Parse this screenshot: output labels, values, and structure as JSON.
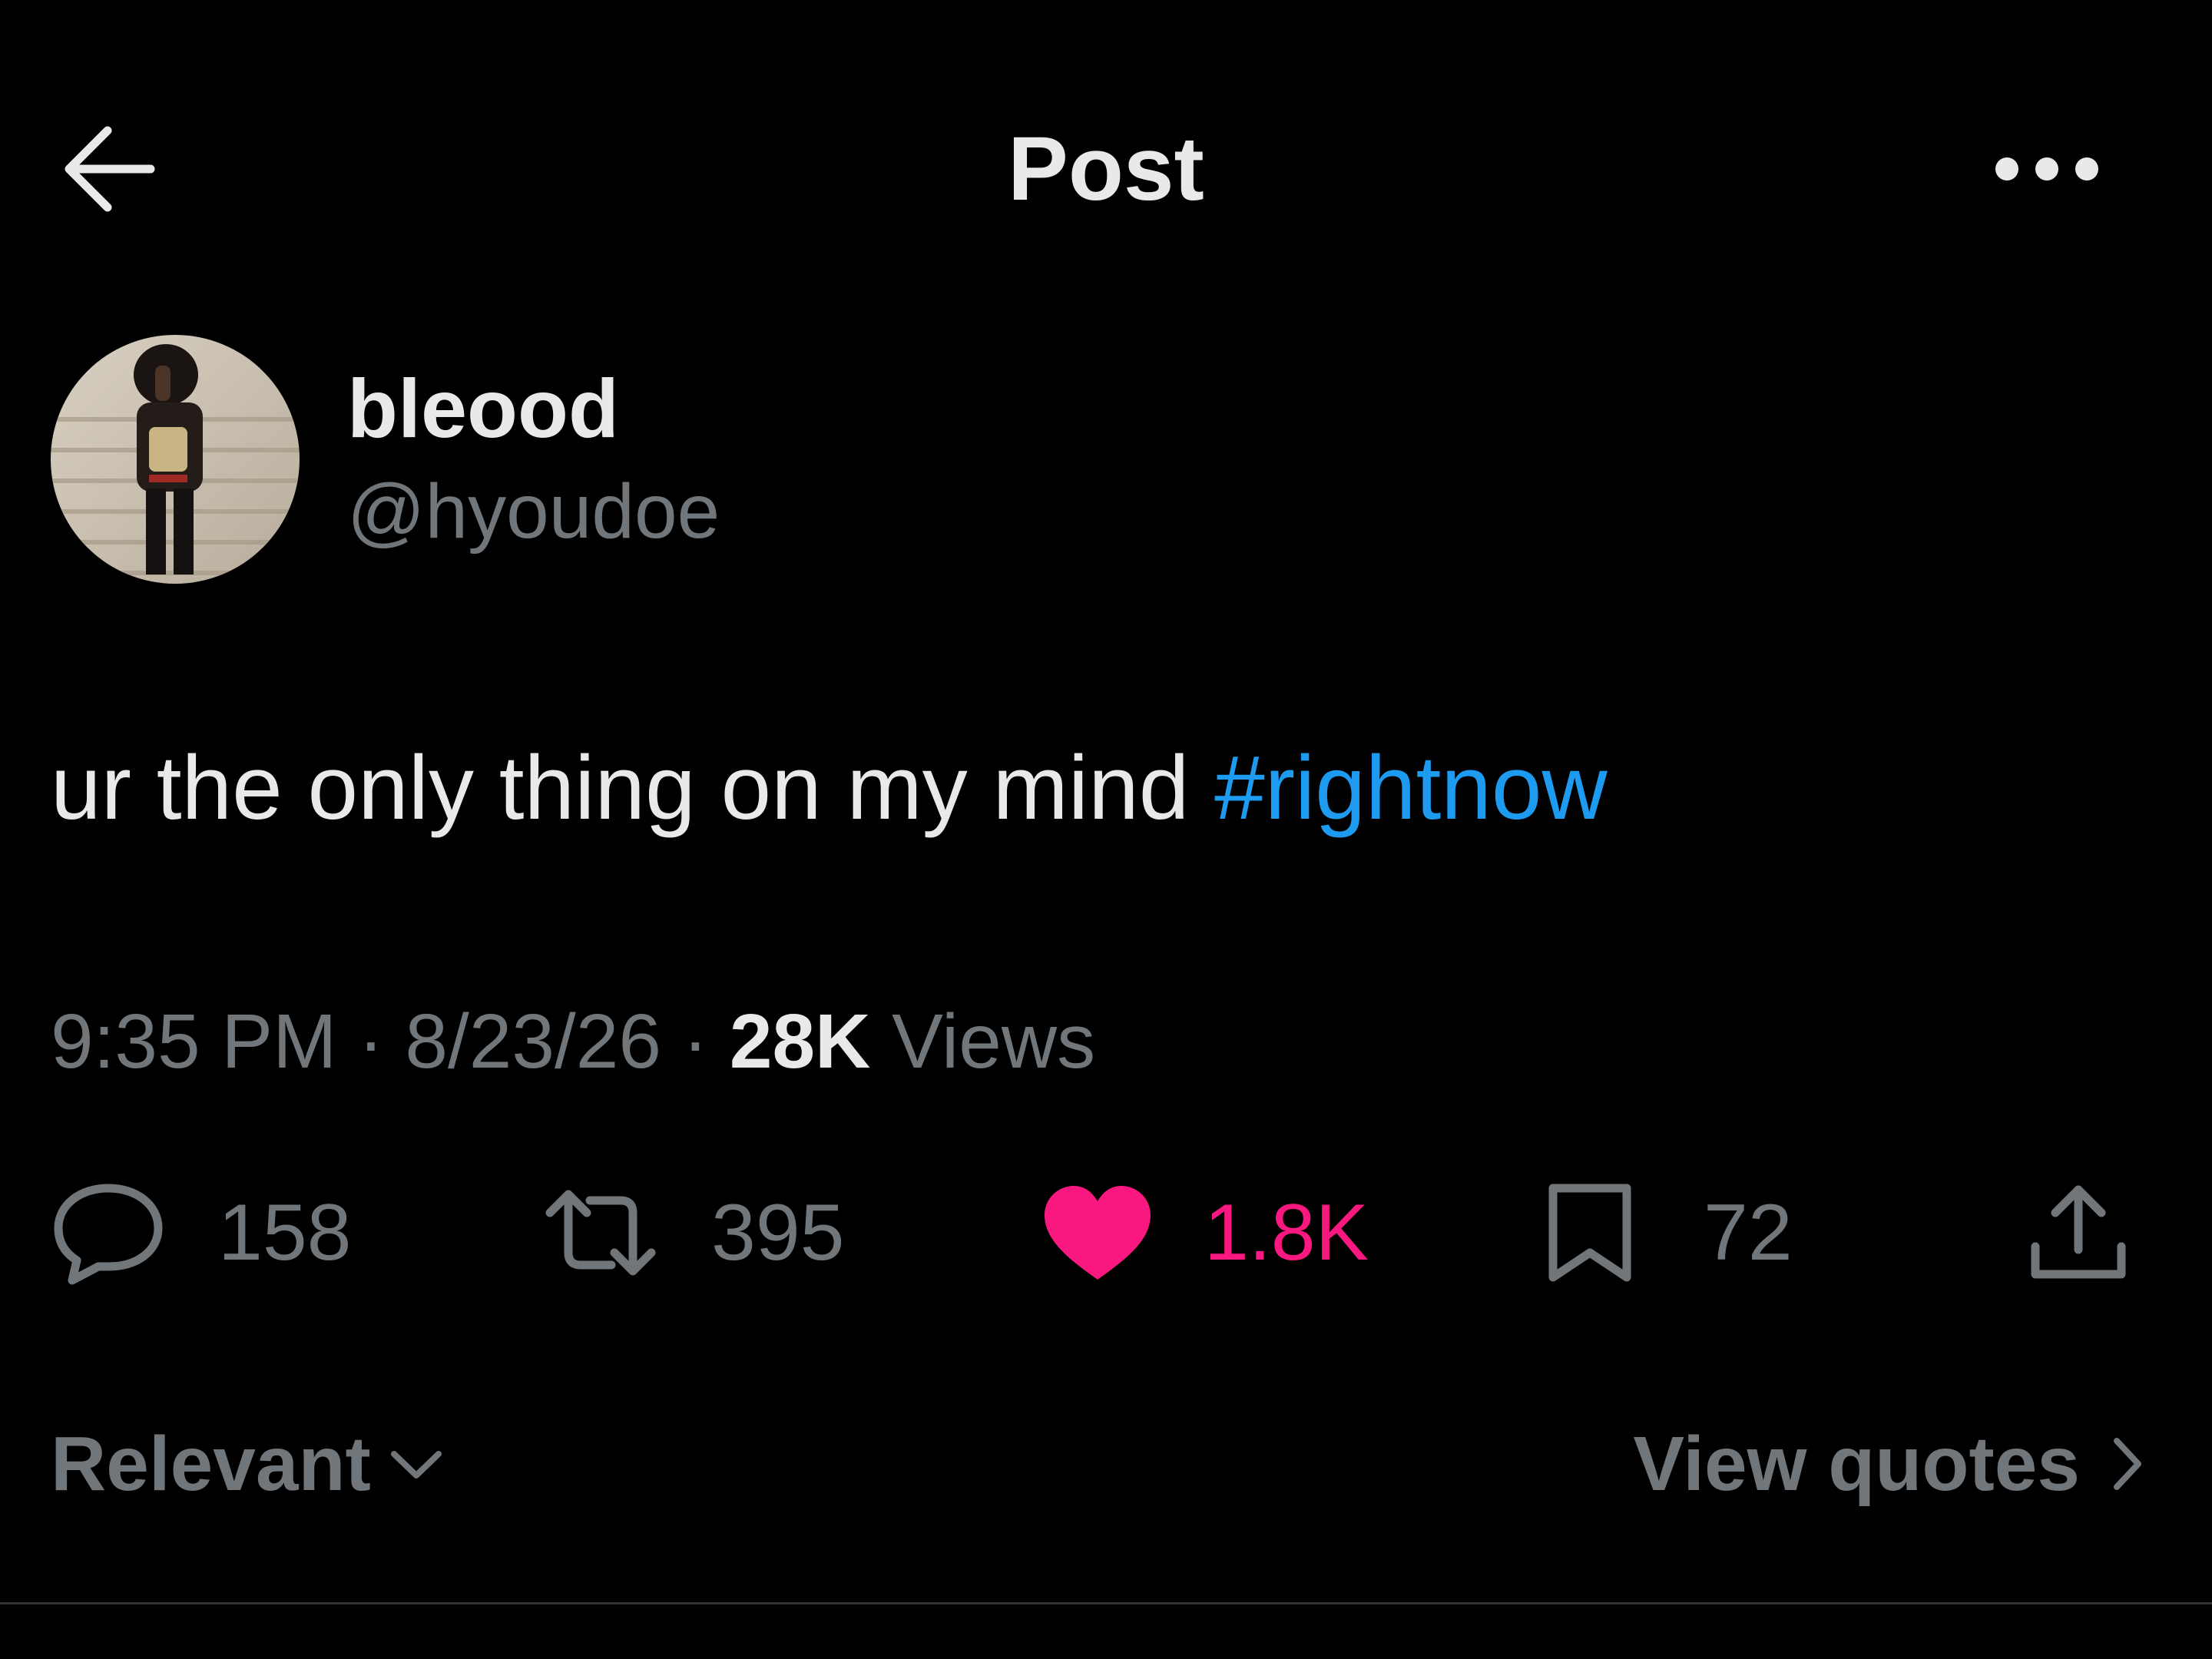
{
  "header": {
    "title": "Post",
    "back_icon": "arrow-left-icon",
    "more_icon": "ellipsis-icon"
  },
  "author": {
    "display_name": "bleood",
    "handle": "@hyoudoe",
    "avatar_icon": "avatar-photo"
  },
  "post": {
    "text": "ur the only thing on my mind",
    "hashtag": "#rightnow"
  },
  "meta": {
    "time": "9:35 PM",
    "separator": "·",
    "date": "8/23/26",
    "views_count": "28K",
    "views_label": "Views"
  },
  "actions": {
    "replies": "158",
    "reposts": "395",
    "likes": "1.8K",
    "bookmarks": "72",
    "icons": [
      "reply-icon",
      "repost-icon",
      "heart-icon",
      "bookmark-icon",
      "share-icon"
    ]
  },
  "replies_sort": {
    "label": "Relevant"
  },
  "quotes_link": {
    "label": "View quotes"
  },
  "colors": {
    "background": "#000000",
    "text_primary": "#e7e9ea",
    "text_secondary": "#71767b",
    "link": "#1d9bf0",
    "like": "#f91880",
    "divider": "#2f3336"
  }
}
